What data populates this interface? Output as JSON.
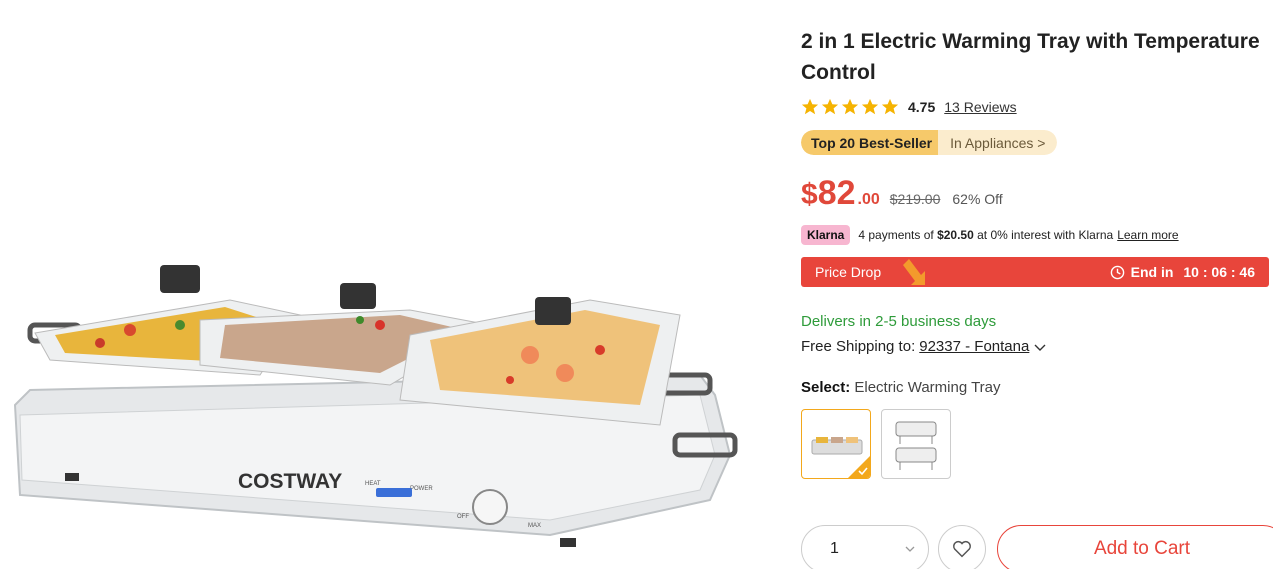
{
  "product": {
    "title": "2 in 1 Electric Warming Tray with Temperature Control",
    "rating": "4.75",
    "reviews_label": "13 Reviews",
    "stars_filled": 5
  },
  "badge": {
    "bestseller_label": "Top 20 Best-Seller",
    "category_label": "In Appliances >"
  },
  "price": {
    "currency": "$",
    "integer": "82",
    "cents": ".00",
    "original": "$219.00",
    "discount": "62% Off"
  },
  "klarna": {
    "badge": "Klarna",
    "text_prefix": "4 payments of",
    "amount": "$20.50",
    "text_suffix": "at 0% interest with Klarna",
    "learn_more": "Learn more"
  },
  "price_drop": {
    "label": "Price Drop",
    "end_label": "End in",
    "countdown": "10 : 06 : 46"
  },
  "delivery": {
    "eta": "Delivers in 2-5 business days",
    "shipping_label": "Free Shipping to:",
    "zip": "92337 - Fontana"
  },
  "select": {
    "label": "Select:",
    "value": "Electric Warming Tray"
  },
  "image_brand": {
    "brand": "COSTWAY",
    "heat": "HEAT",
    "power": "POWER",
    "off": "OFF",
    "max": "MAX"
  },
  "cart": {
    "quantity": "1",
    "add_label": "Add to Cart"
  },
  "colors": {
    "accent": "#e8453b",
    "star": "#f5b301",
    "green": "#2e9b3a",
    "bestseller": "#f6c96a",
    "klarna": "#f7b6d0"
  }
}
